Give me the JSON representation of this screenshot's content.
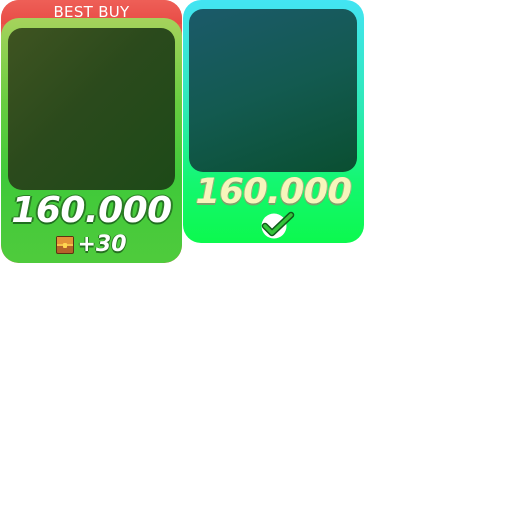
{
  "offers": [
    {
      "ribbon_label": "BEST BUY",
      "amount": "160.000",
      "bonus_label": "+30",
      "bonus_icon": "treasure-chest-icon",
      "colors": {
        "ribbon": "#e84c46",
        "card": "#4fcb3c",
        "well": "#2b4a1c"
      }
    },
    {
      "amount": "160.000",
      "status_icon": "checkmark-icon",
      "colors": {
        "card": "#14f770",
        "well": "#135a50"
      }
    }
  ]
}
